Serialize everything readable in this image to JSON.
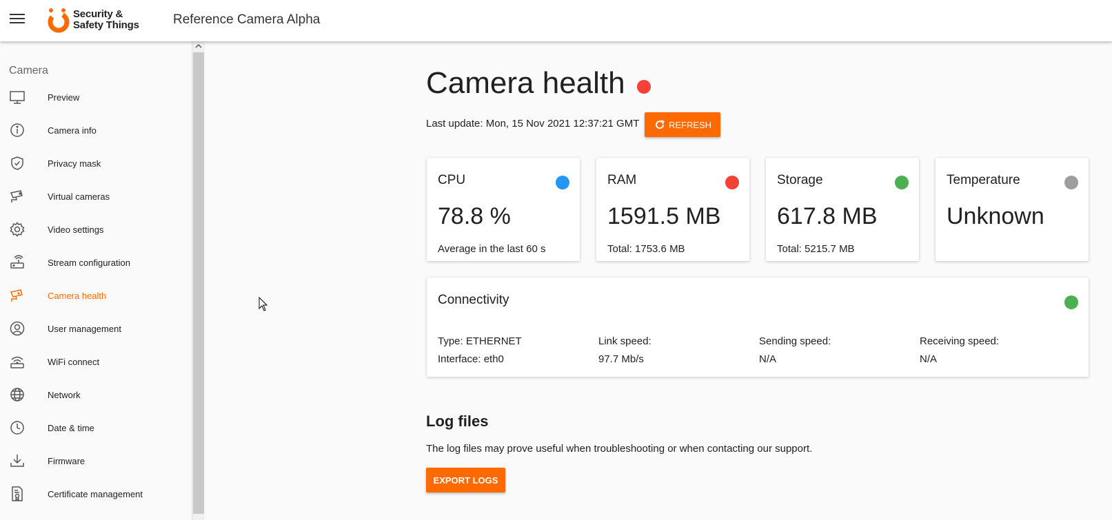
{
  "header": {
    "logo_line1": "Security &",
    "logo_line2": "Safety Things",
    "app_title": "Reference Camera Alpha"
  },
  "sidebar": {
    "section_title": "Camera",
    "items": [
      {
        "label": "Preview",
        "icon": "monitor-icon"
      },
      {
        "label": "Camera info",
        "icon": "info-icon"
      },
      {
        "label": "Privacy mask",
        "icon": "shield-icon"
      },
      {
        "label": "Virtual cameras",
        "icon": "cctv-icon"
      },
      {
        "label": "Video settings",
        "icon": "gear-icon"
      },
      {
        "label": "Stream configuration",
        "icon": "router-icon"
      },
      {
        "label": "Camera health",
        "icon": "camera-health-icon",
        "active": true
      },
      {
        "label": "User management",
        "icon": "user-icon"
      },
      {
        "label": "WiFi connect",
        "icon": "wifi-icon"
      },
      {
        "label": "Network",
        "icon": "globe-icon"
      },
      {
        "label": "Date & time",
        "icon": "clock-icon"
      },
      {
        "label": "Firmware",
        "icon": "download-icon"
      },
      {
        "label": "Certificate management",
        "icon": "certificate-icon"
      }
    ]
  },
  "main": {
    "title": "Camera health",
    "title_status_color": "#f44336",
    "last_update": "Last update: Mon, 15 Nov 2021 12:37:21 GMT",
    "refresh_label": "REFRESH",
    "cards": {
      "cpu": {
        "title": "CPU",
        "value": "78.8 %",
        "sub": "Average in the last 60 s",
        "status_color": "#2196f3"
      },
      "ram": {
        "title": "RAM",
        "value": "1591.5 MB",
        "sub": "Total: 1753.6 MB",
        "status_color": "#f44336"
      },
      "storage": {
        "title": "Storage",
        "value": "617.8 MB",
        "sub": "Total: 5215.7 MB",
        "status_color": "#4caf50"
      },
      "temperature": {
        "title": "Temperature",
        "value": "Unknown",
        "status_color": "#9e9e9e"
      }
    },
    "connectivity": {
      "title": "Connectivity",
      "status_color": "#4caf50",
      "type": "Type: ETHERNET",
      "interface": "Interface: eth0",
      "link_speed_label": "Link speed:",
      "link_speed_value": "97.7 Mb/s",
      "sending_label": "Sending speed:",
      "sending_value": "N/A",
      "receiving_label": "Receiving speed:",
      "receiving_value": "N/A"
    },
    "logs": {
      "title": "Log files",
      "description": "The log files may prove useful when troubleshooting or when contacting our support.",
      "export_label": "EXPORT LOGS"
    }
  },
  "colors": {
    "accent": "#ff6a00"
  }
}
